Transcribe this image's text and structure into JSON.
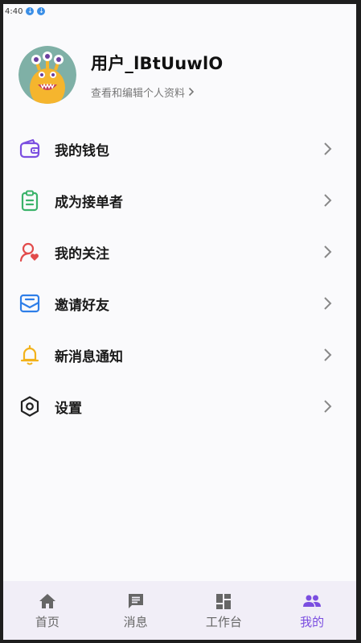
{
  "status_bar": {
    "time": "4:40"
  },
  "profile": {
    "username": "用户_lBtUuwlO",
    "subtitle": "查看和编辑个人资料"
  },
  "menu": {
    "items": [
      {
        "label": "我的钱包",
        "icon": "wallet-icon",
        "color": "#7b4ee0"
      },
      {
        "label": "成为接单者",
        "icon": "clipboard-icon",
        "color": "#3bb36a"
      },
      {
        "label": "我的关注",
        "icon": "follow-heart-icon",
        "color": "#e24b4b"
      },
      {
        "label": "邀请好友",
        "icon": "envelope-icon",
        "color": "#2e7ee8"
      },
      {
        "label": "新消息通知",
        "icon": "bell-icon",
        "color": "#f2b21c"
      },
      {
        "label": "设置",
        "icon": "settings-hexagon-icon",
        "color": "#222222"
      }
    ]
  },
  "tabbar": {
    "active_color": "#7b4ee0",
    "items": [
      {
        "label": "首页",
        "icon": "home-icon",
        "active": false
      },
      {
        "label": "消息",
        "icon": "message-icon",
        "active": false
      },
      {
        "label": "工作台",
        "icon": "dashboard-icon",
        "active": false
      },
      {
        "label": "我的",
        "icon": "people-icon",
        "active": true
      }
    ]
  }
}
